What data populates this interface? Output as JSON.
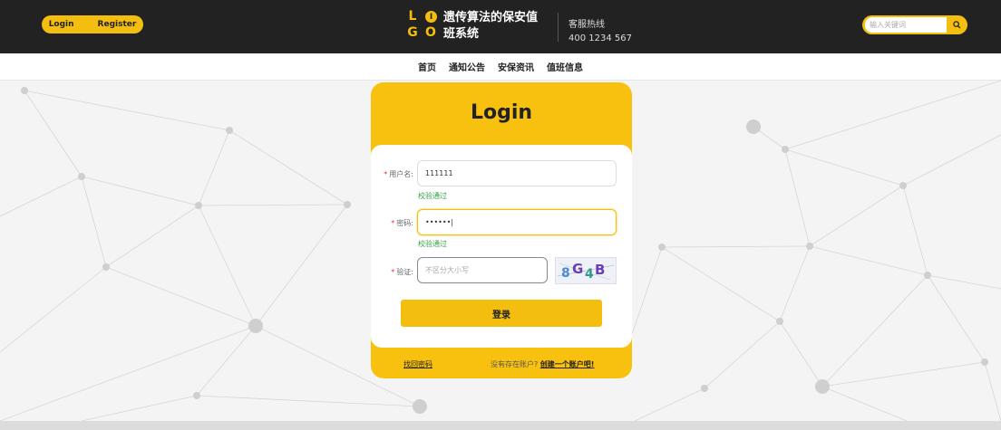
{
  "header": {
    "login_label": "Login",
    "register_label": "Register",
    "logo_letters": [
      "L",
      "G",
      "O"
    ],
    "logo_dot_letter": "I",
    "site_title": "遗传算法的保安值班系统",
    "hotline_label": "客服热线",
    "hotline_number": "400 1234 567",
    "search_placeholder": "输入关键词",
    "search_icon": "search-icon"
  },
  "nav": {
    "items": [
      "首页",
      "通知公告",
      "安保资讯",
      "值班信息"
    ]
  },
  "login_form": {
    "title": "Login",
    "username_label": "用户名:",
    "username_value": "111111",
    "username_status": "校验通过",
    "password_label": "密码:",
    "password_value": "••••••|",
    "password_status": "校验通过",
    "captcha_label": "验证:",
    "captcha_placeholder": "不区分大小写",
    "captcha_text": "8G4B",
    "submit_label": "登录",
    "forgot_label": "找回密码",
    "no_account_text": "没有存在账户?",
    "create_account_label": "创建一个账户吧!"
  },
  "colors": {
    "accent": "#f4be10",
    "header_bg": "#222222",
    "success": "#3aa04a",
    "required": "#e33333"
  }
}
